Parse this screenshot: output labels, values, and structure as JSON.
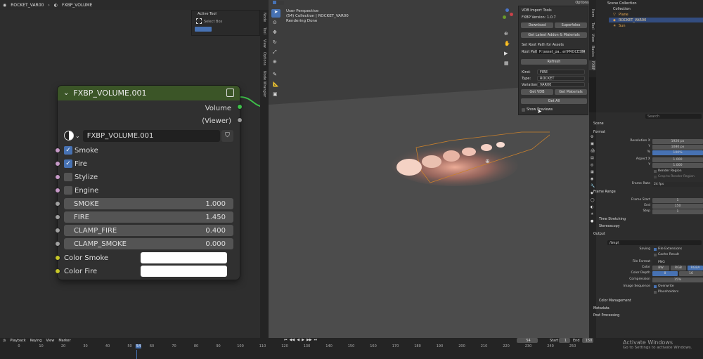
{
  "topbar": {
    "scene": "ROCKET_VAR00",
    "object": "FXBP_VOLUME"
  },
  "tool_panel": {
    "title": "Active Tool",
    "tool": "Select Box"
  },
  "left_tabs": [
    "Node",
    "Tool",
    "View",
    "Options",
    "Node Wrangler"
  ],
  "node": {
    "title": "FXBP_VOLUME.001",
    "outputs": [
      "Volume",
      "(Viewer)"
    ],
    "group": "FXBP_VOLUME.001",
    "toggles": [
      {
        "label": "Smoke",
        "checked": true
      },
      {
        "label": "Fire",
        "checked": true
      },
      {
        "label": "Stylize",
        "checked": false
      },
      {
        "label": "Engine",
        "checked": false
      }
    ],
    "fields": [
      {
        "label": "SMOKE",
        "value": "1.000"
      },
      {
        "label": "FIRE",
        "value": "1.450"
      },
      {
        "label": "CLAMP_FIRE",
        "value": "0.400"
      },
      {
        "label": "CLAMP_SMOKE",
        "value": "0.000"
      }
    ],
    "colors": [
      {
        "label": "Color Smoke",
        "color": "#ffffff"
      },
      {
        "label": "Color Fire",
        "color": "#ffffff"
      }
    ]
  },
  "viewport": {
    "line1": "User Perspective",
    "line2": "(54) Collection | ROCKET_VAR00",
    "line3": "Rendering Done",
    "options": "Options"
  },
  "npanel": {
    "title": "VDB Import Tools",
    "version": "FXBP Version: 1.0.7",
    "download": "Download",
    "superfluous": "Superfolex",
    "get_latest": "Get Latest Addon & Materials",
    "root_label": "Set Root Path for Assets",
    "root_path_label": "Root Path:",
    "root_path": "P:\\asset_pa...er\\PROCESS\\",
    "refresh": "Refresh",
    "kind_label": "Kind:",
    "kind": "FIRE",
    "type_label": "Type:",
    "type": "ROCKET",
    "variation_label": "Variation:",
    "variation": "VAR00",
    "get_vdb": "Get VDB",
    "get_materials": "Get Materials",
    "get_all": "Get All",
    "show_previews": "Show Previews"
  },
  "right_tabs": [
    "Item",
    "Tool",
    "View",
    "Basics",
    "FXBP"
  ],
  "outliner": {
    "root": "Scene Collection",
    "items": [
      "Collection",
      "Plane",
      "ROCKET_VAR00",
      "Sun"
    ]
  },
  "props": {
    "search_placeholder": "Search",
    "scene": "Scene",
    "format": "Format",
    "rows": [
      {
        "label": "Resolution X",
        "value": "1920 px"
      },
      {
        "label": "Y",
        "value": "1080 px"
      },
      {
        "label": "%",
        "value": "100%"
      },
      {
        "label": "Aspect X",
        "value": "1.000"
      },
      {
        "label": "Y",
        "value": "1.000"
      }
    ],
    "render_region": "Render Region",
    "crop": "Crop to Render Region",
    "frame_rate_label": "Frame Rate",
    "frame_rate": "24 fps",
    "frame_range": "Frame Range",
    "range_rows": [
      {
        "label": "Frame Start",
        "value": "1"
      },
      {
        "label": "End",
        "value": "150"
      },
      {
        "label": "Step",
        "value": "1"
      }
    ],
    "time_stretching": "Time Stretching",
    "stereoscopy": "Stereoscopy",
    "output": "Output",
    "output_path": "/tmp\\",
    "saving_label": "Saving",
    "file_extensions": "File Extensions",
    "cache_result": "Cache Result",
    "file_format_label": "File Format",
    "file_format": "PNG",
    "color_label": "Color",
    "color_opts": [
      "BW",
      "RGB",
      "RGBA"
    ],
    "depth_label": "Color Depth",
    "depth_opts": [
      "8",
      "16"
    ],
    "compression_label": "Compression",
    "compression": "15%",
    "image_sequence_label": "Image Sequence",
    "overwrite": "Overwrite",
    "placeholders": "Placeholders",
    "color_management": "Color Management",
    "metadata": "Metadata",
    "post_processing": "Post Processing"
  },
  "timeline": {
    "menus": [
      "Playback",
      "Keying",
      "View",
      "Marker"
    ],
    "current": "54",
    "start_label": "Start",
    "start": "1",
    "end_label": "End",
    "end": "150",
    "ticks": [
      "0",
      "10",
      "20",
      "30",
      "40",
      "50",
      "54",
      "60",
      "70",
      "80",
      "90",
      "100",
      "110",
      "120",
      "130",
      "140",
      "150",
      "160",
      "170",
      "180",
      "190",
      "200",
      "210",
      "220",
      "230",
      "240",
      "250"
    ]
  },
  "watermark": {
    "line1": "Activate Windows",
    "line2": "Go to Settings to activate Windows."
  }
}
